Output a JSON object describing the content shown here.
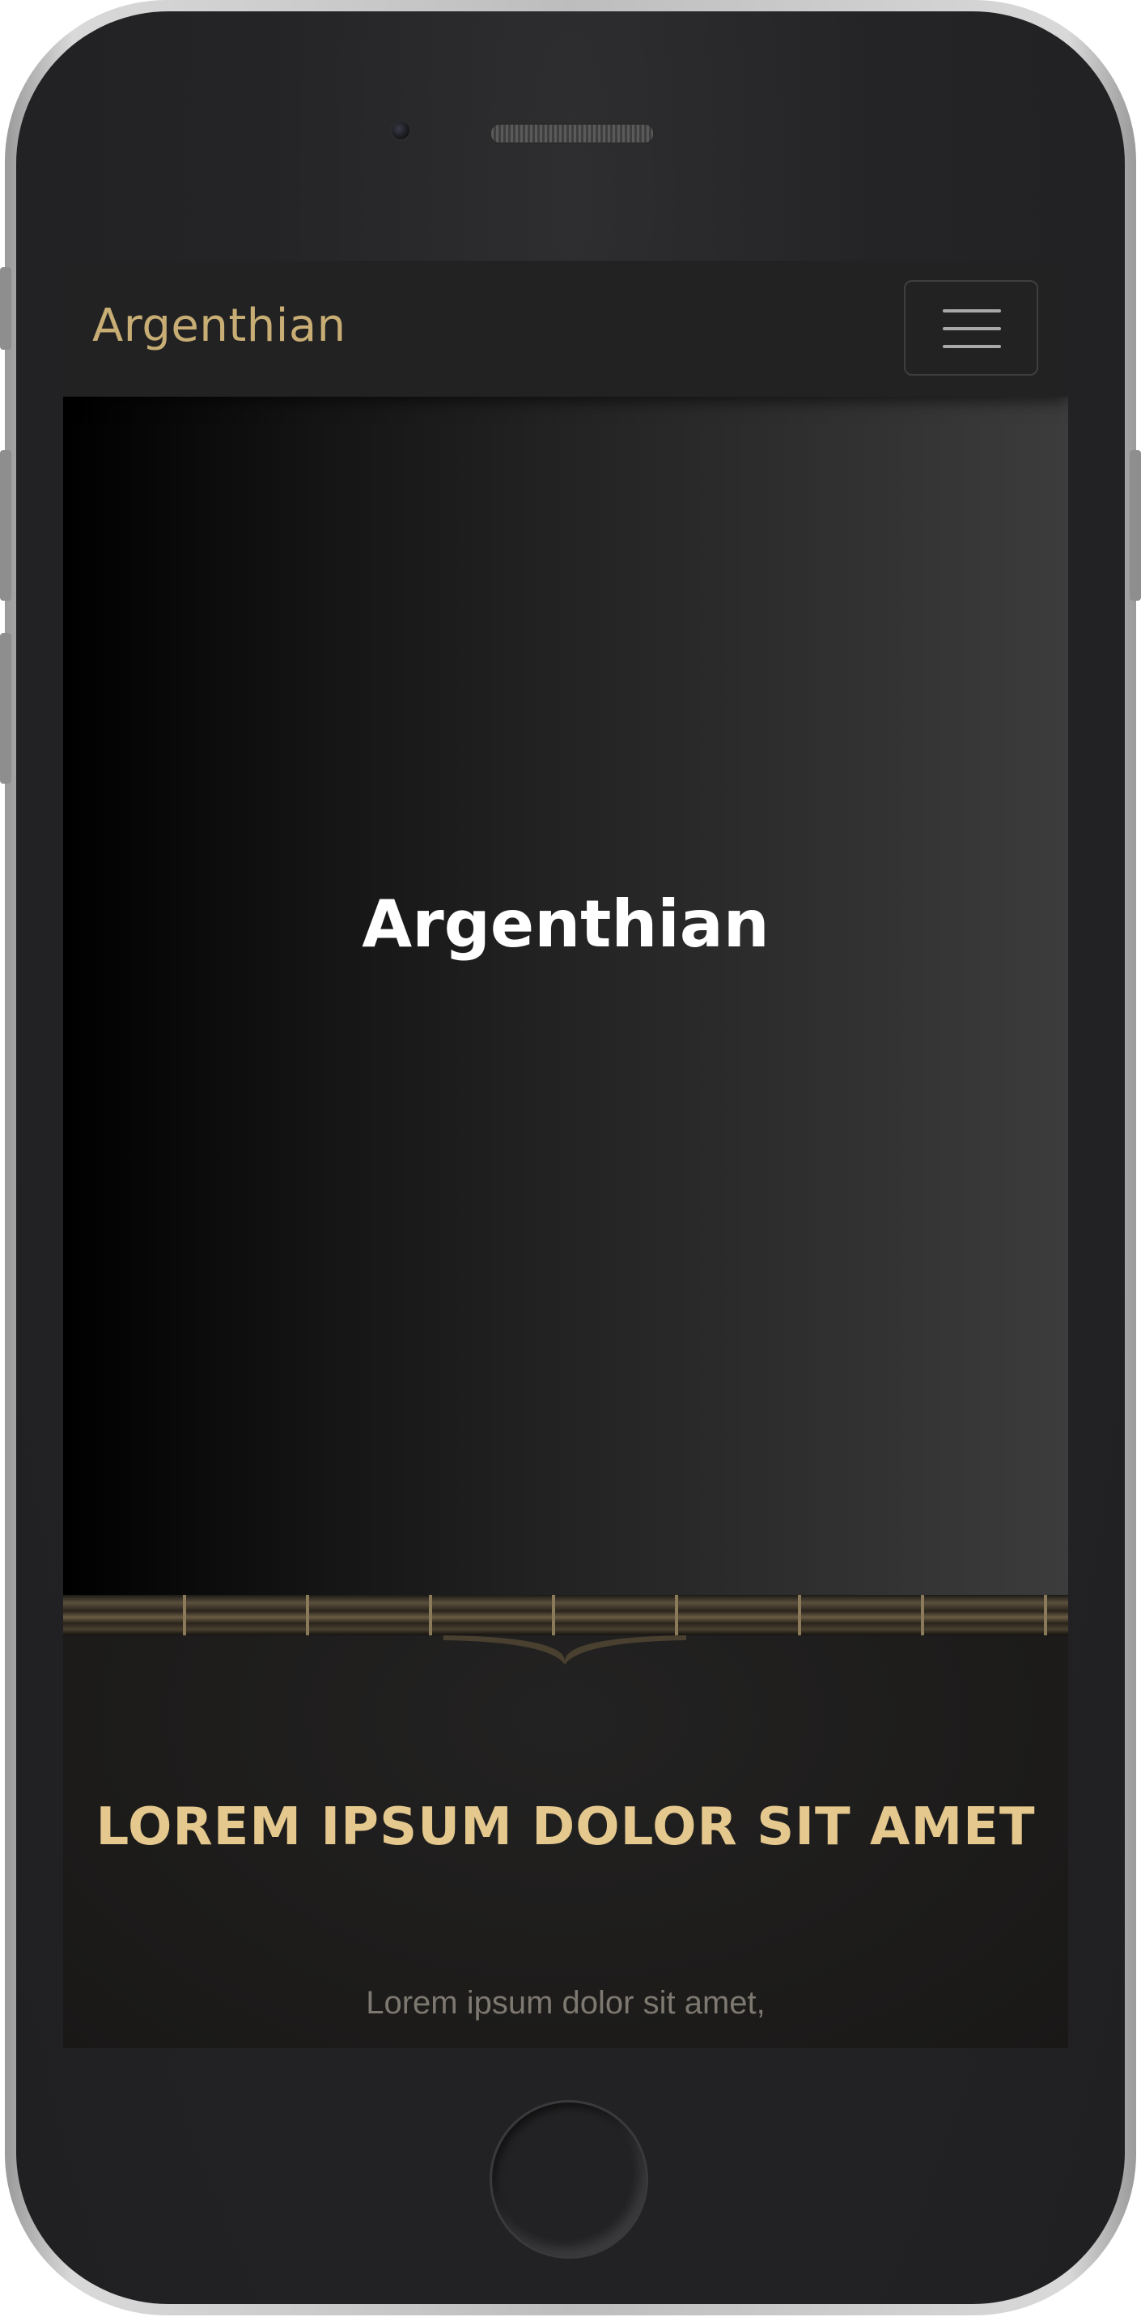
{
  "navbar": {
    "brand": "Argenthian",
    "toggler_icon": "hamburger-menu-icon"
  },
  "hero": {
    "title": "Argenthian"
  },
  "section": {
    "title": "LOREM IPSUM DOLOR SIT AMET",
    "text": "Lorem ipsum dolor sit amet,"
  },
  "colors": {
    "brand": "#c8ad74",
    "section_title": "#e5c88d",
    "navbar_bg": "#222223"
  }
}
